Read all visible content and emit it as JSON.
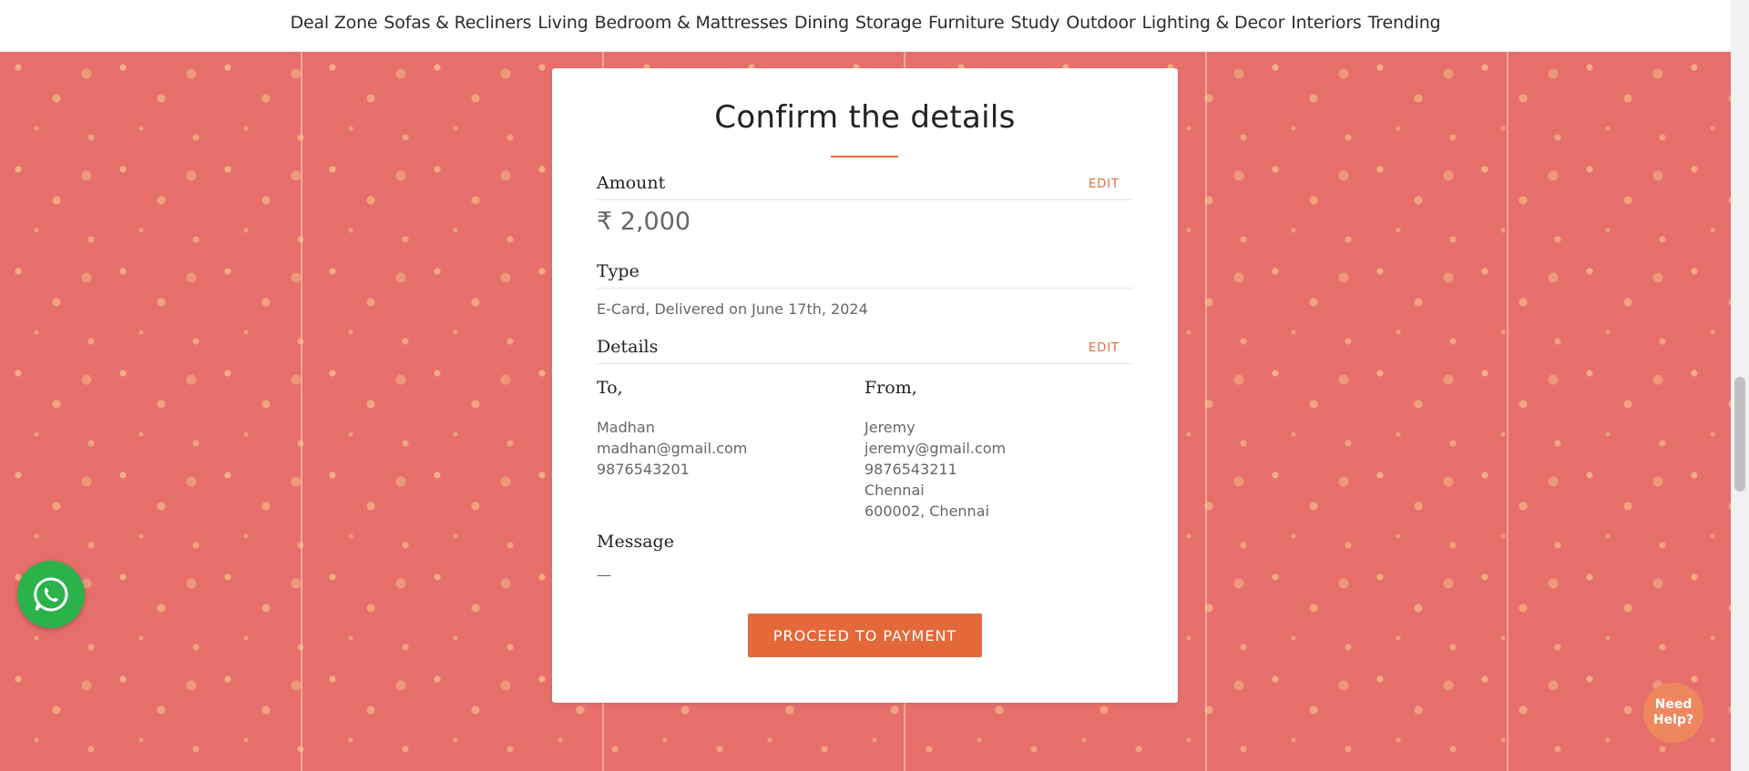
{
  "nav": {
    "items": [
      "Deal Zone",
      "Sofas & Recliners",
      "Living",
      "Bedroom & Mattresses",
      "Dining",
      "Storage",
      "Furniture",
      "Study",
      "Outdoor",
      "Lighting & Decor",
      "Interiors",
      "Trending"
    ]
  },
  "card": {
    "title": "Confirm the details",
    "amount_section": {
      "label": "Amount",
      "edit": "EDIT",
      "value": "₹ 2,000"
    },
    "type_section": {
      "label": "Type",
      "value": "E-Card, Delivered on June 17th, 2024"
    },
    "details_section": {
      "label": "Details",
      "edit": "EDIT",
      "to": {
        "heading": "To,",
        "lines": [
          "Madhan",
          "madhan@gmail.com",
          "9876543201"
        ]
      },
      "from": {
        "heading": "From,",
        "lines": [
          "Jeremy",
          "jeremy@gmail.com",
          "9876543211",
          "Chennai",
          "600002, Chennai"
        ]
      }
    },
    "message_section": {
      "label": "Message",
      "value": "—"
    },
    "proceed_button": "PROCEED TO PAYMENT"
  },
  "help_widget": {
    "label": "Need Help?"
  },
  "colors": {
    "accent": "#e3693a",
    "background_pattern": "#e66f6c",
    "whatsapp": "#2ab34a",
    "help": "#ee875e"
  },
  "icons": {
    "whatsapp": "whatsapp-icon"
  }
}
